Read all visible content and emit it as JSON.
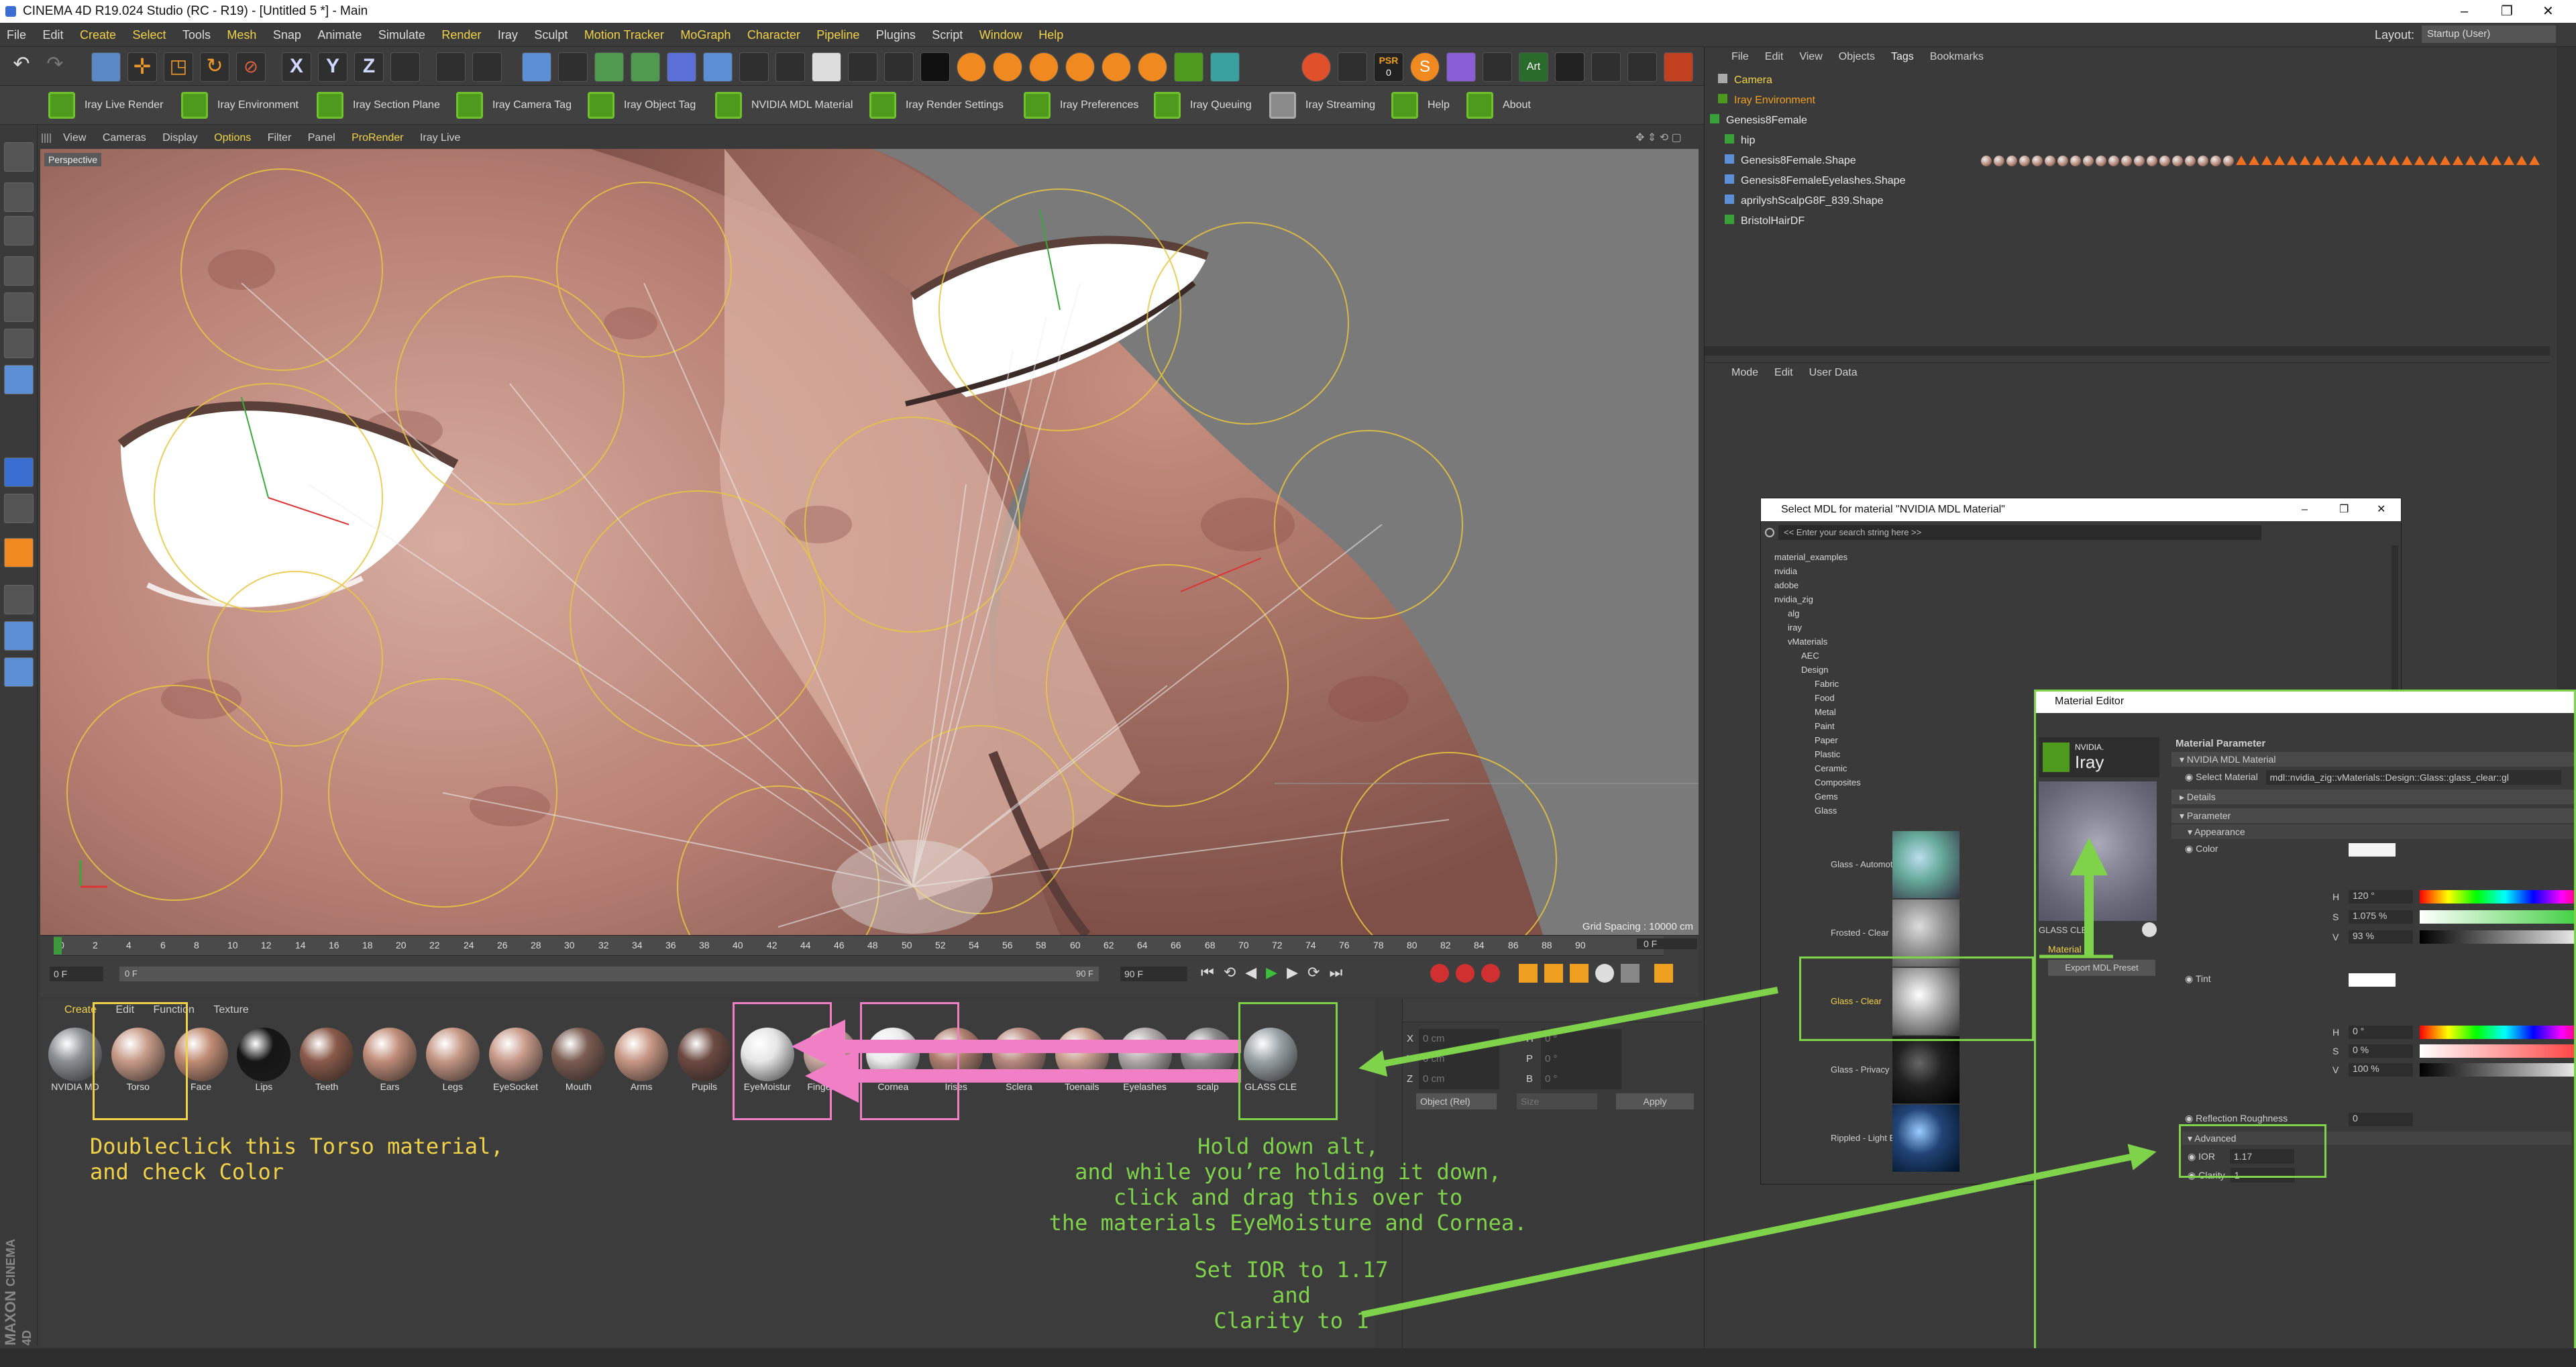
{
  "window": {
    "title": "CINEMA 4D R19.024 Studio (RC - R19) - [Untitled 5 *] - Main",
    "controls": [
      "–",
      "❐",
      "✕"
    ]
  },
  "menu": {
    "items": [
      "File",
      "Edit",
      "Create",
      "Select",
      "Tools",
      "Mesh",
      "Snap",
      "Animate",
      "Simulate",
      "Render",
      "Iray",
      "Sculpt",
      "Motion Tracker",
      "MoGraph",
      "Character",
      "Pipeline",
      "Plugins",
      "Script",
      "Window",
      "Help"
    ],
    "layout_label": "Layout:",
    "layout_value": "Startup (User)"
  },
  "toolbar1": {
    "psr": "PSR",
    "psr_value": "0",
    "art": "Art"
  },
  "iray_toolbar": [
    "Iray Live Render",
    "Iray Environment",
    "Iray Section Plane",
    "Iray Camera Tag",
    "Iray Object Tag",
    "NVIDIA MDL Material",
    "Iray Render Settings",
    "Iray Preferences",
    "Iray Queuing",
    "Iray Streaming",
    "Help",
    "About"
  ],
  "viewport": {
    "menu": [
      "View",
      "Cameras",
      "Display",
      "Options",
      "Filter",
      "Panel",
      "ProRender",
      "Iray Live"
    ],
    "label": "Perspective",
    "grid_spacing": "Grid Spacing : 10000 cm"
  },
  "timeline": {
    "ticks": [
      "0",
      "2",
      "4",
      "6",
      "8",
      "10",
      "12",
      "14",
      "16",
      "18",
      "20",
      "22",
      "24",
      "26",
      "28",
      "30",
      "32",
      "34",
      "36",
      "38",
      "40",
      "42",
      "44",
      "46",
      "48",
      "50",
      "52",
      "54",
      "56",
      "58",
      "60",
      "62",
      "64",
      "66",
      "68",
      "70",
      "72",
      "74",
      "76",
      "78",
      "80",
      "82",
      "84",
      "86",
      "88",
      "90"
    ],
    "current": "0 F",
    "start": "0 F",
    "end": "90 F",
    "end2": "90 F",
    "right": "0 F"
  },
  "material_manager": {
    "tabs": [
      "Create",
      "Edit",
      "Function",
      "Texture"
    ],
    "materials": [
      {
        "name": "NVIDIA MD",
        "color": "#8a8f93"
      },
      {
        "name": "Torso",
        "color": "#c79a88"
      },
      {
        "name": "Face",
        "color": "#c08c74"
      },
      {
        "name": "Lips",
        "color": "#161616"
      },
      {
        "name": "Teeth",
        "color": "#8a5a4a"
      },
      {
        "name": "Ears",
        "color": "#c08c78"
      },
      {
        "name": "Legs",
        "color": "#c49684"
      },
      {
        "name": "EyeSocket",
        "color": "#c89a8a"
      },
      {
        "name": "Mouth",
        "color": "#7a5c52"
      },
      {
        "name": "Arms",
        "color": "#c89684"
      },
      {
        "name": "Pupils",
        "color": "#6c4a42"
      },
      {
        "name": "EyeMoistur",
        "color": "#e6e6e6"
      },
      {
        "name": "Fingernails",
        "color": "#c8a8a0"
      },
      {
        "name": "Cornea",
        "color": "#ececec"
      },
      {
        "name": "Irises",
        "color": "#b08070"
      },
      {
        "name": "Sclera",
        "color": "#b88a80"
      },
      {
        "name": "Toenails",
        "color": "#c8a090"
      },
      {
        "name": "Eyelashes",
        "color": "#b0a8a8"
      },
      {
        "name": "scalp",
        "color": "#8a8a8a"
      },
      {
        "name": "GLASS CLE",
        "color": "#9aa2a6"
      }
    ]
  },
  "coords": {
    "x": "X",
    "y": "Y",
    "z": "Z",
    "h": "H",
    "p": "P",
    "b": "B",
    "x_val": "0 cm",
    "y_val": "0 cm",
    "z_val": "0 cm",
    "h_val": "0 °",
    "p_val": "0 °",
    "b_val": "0 °",
    "mode": "Object (Rel)",
    "size": "Size",
    "apply": "Apply"
  },
  "object_manager": {
    "menu": [
      "File",
      "Edit",
      "View",
      "Objects",
      "Tags",
      "Bookmarks"
    ],
    "objects": [
      "Camera",
      "Iray Environment",
      "Genesis8Female",
      "hip",
      "Genesis8Female.Shape",
      "Genesis8FemaleEyelashes.Shape",
      "aprilyshScalpG8F_839.Shape",
      "BristolHairDF"
    ]
  },
  "attributes": {
    "menu": [
      "Mode",
      "Edit",
      "User Data"
    ]
  },
  "mdl_dialog": {
    "title": "Select MDL for material \"NVIDIA MDL Material\"",
    "search_placeholder": "<< Enter your search string here >>",
    "tree": [
      "material_examples",
      "nvidia",
      "adobe",
      "nvidia_zig",
      "alg",
      "iray",
      "vMaterials",
      "AEC",
      "Design",
      "Fabric",
      "Food",
      "Metal",
      "Paint",
      "Paper",
      "Plastic",
      "Ceramic",
      "Composites",
      "Gems",
      "Glass"
    ],
    "presets": [
      "Glass - Automotive",
      "Frosted - Clear",
      "Glass - Clear",
      "Glass - Privacy",
      "Rippled - Light Blue"
    ]
  },
  "material_editor": {
    "title": "Material Editor",
    "brand_top": "NVIDIA.",
    "brand_bottom": "Iray",
    "preview_name": "GLASS CLEA",
    "side_label": "Material",
    "export_btn": "Export MDL Preset",
    "section": "Material Parameter",
    "mdl_title": "NVIDIA MDL Material",
    "select_material_label": "Select Material",
    "select_material_value": "mdl::nvidia_zig::vMaterials::Design::Glass::glass_clear::gl",
    "details": "Details",
    "parameter": "Parameter",
    "appearance": "Appearance",
    "color": "Color",
    "tint": "Tint",
    "h_label": "H",
    "s_label": "S",
    "v_label": "V",
    "color_h": "120 °",
    "color_s": "1.075 %",
    "color_v": "93 %",
    "tint_h": "0 °",
    "tint_s": "0 %",
    "tint_v": "100 %",
    "refl_rough": "Reflection Roughness",
    "refl_rough_val": "0",
    "advanced": "Advanced",
    "ior_label": "IOR",
    "ior_val": "1.17",
    "clarity_label": "Clarity",
    "clarity_val": "1"
  },
  "annotations": {
    "torso_note": [
      "Doubleclick this Torso material,",
      "and check Color"
    ],
    "alt_drag_note": [
      "Hold down alt,",
      "and while you’re holding it down,",
      "click and drag this over to",
      "the materials EyeMoisture and Cornea."
    ],
    "ior_note": [
      "Set IOR to 1.17",
      "and",
      "Clarity to 1"
    ]
  },
  "colors": {
    "accent_yellow": "#f0d24a",
    "annotation_green": "#7fd34b",
    "annotation_pink": "#f07fc6",
    "iray_green": "#4d9a1c"
  },
  "branding": {
    "maxon": "MAXON",
    "c4d": "CINEMA 4D"
  }
}
